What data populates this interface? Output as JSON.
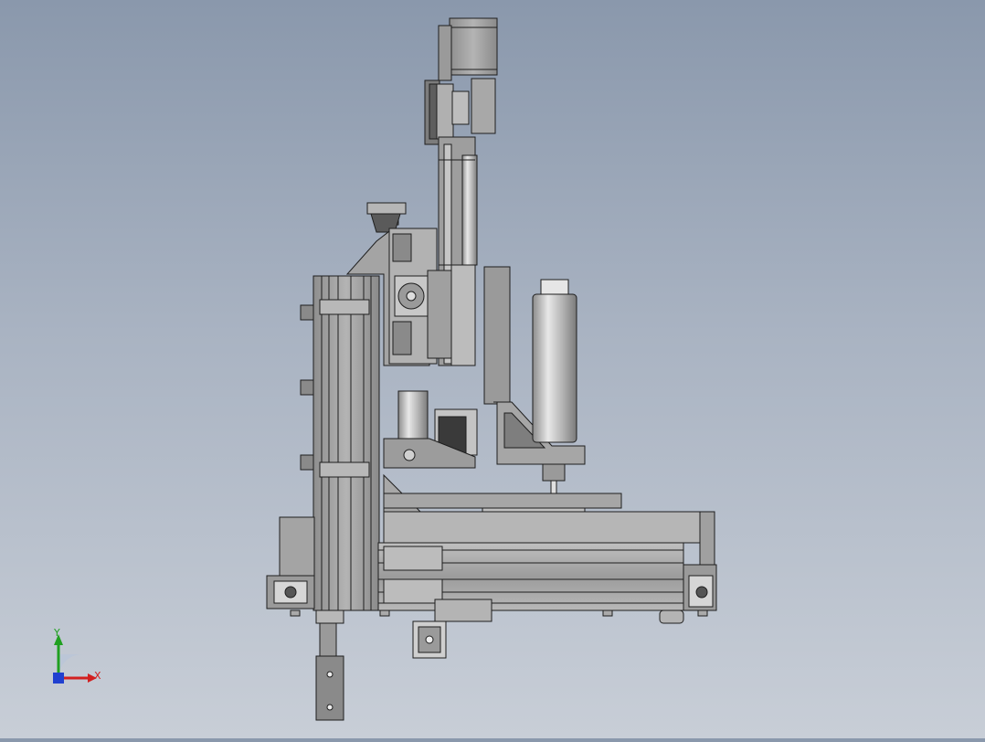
{
  "view": {
    "triad": {
      "x_label": "X",
      "y_label": "Y",
      "x_color": "#d22020",
      "y_color": "#20a020",
      "z_color": "#2040d0"
    },
    "colors": {
      "metal_dark": "#6e6e6e",
      "metal": "#9a9a9a",
      "metal_light": "#c4c4c4",
      "edge": "#1e1e1e"
    }
  }
}
